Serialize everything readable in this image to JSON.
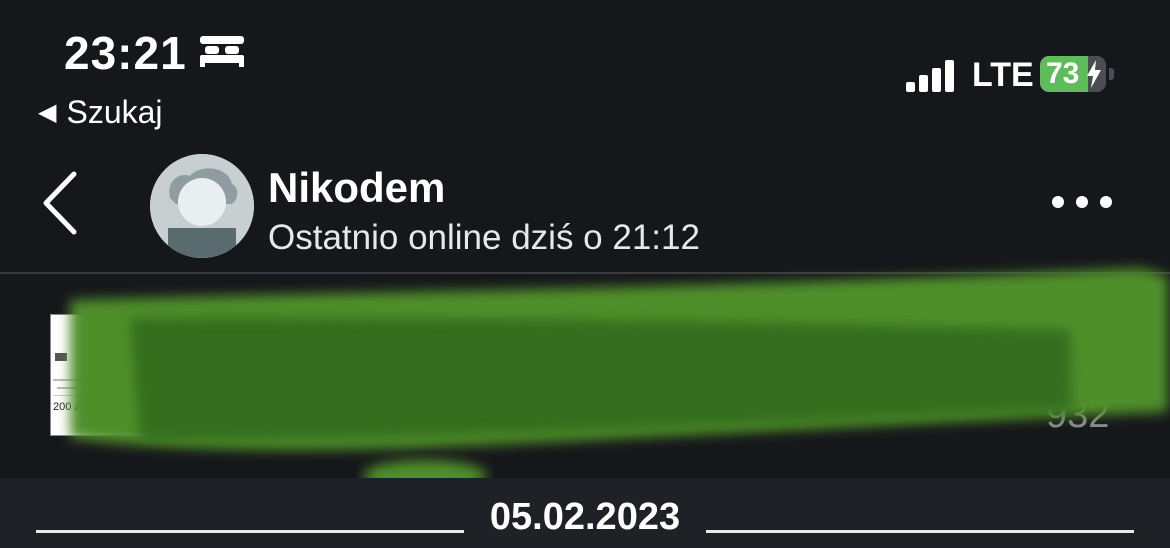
{
  "status_bar": {
    "time": "23:21",
    "back_app_label": "Szukaj",
    "network": "LTE",
    "battery_percent": "73",
    "battery_level": 0.73,
    "icons": [
      "bed-icon",
      "signal-icon",
      "battery-charging-icon"
    ]
  },
  "header": {
    "contact_name": "Nikodem",
    "contact_status": "Ostatnio online dziś o 21:12",
    "icons": [
      "chevron-left-icon",
      "avatar-placeholder",
      "more-icon"
    ]
  },
  "message": {
    "thumbnail_price": "200 zł",
    "time_fragment": "932"
  },
  "date_separator": "05.02.2023",
  "colors": {
    "background": "#16171b",
    "battery_fill": "#5ebd5a",
    "redaction_green": "#3f7a22"
  }
}
